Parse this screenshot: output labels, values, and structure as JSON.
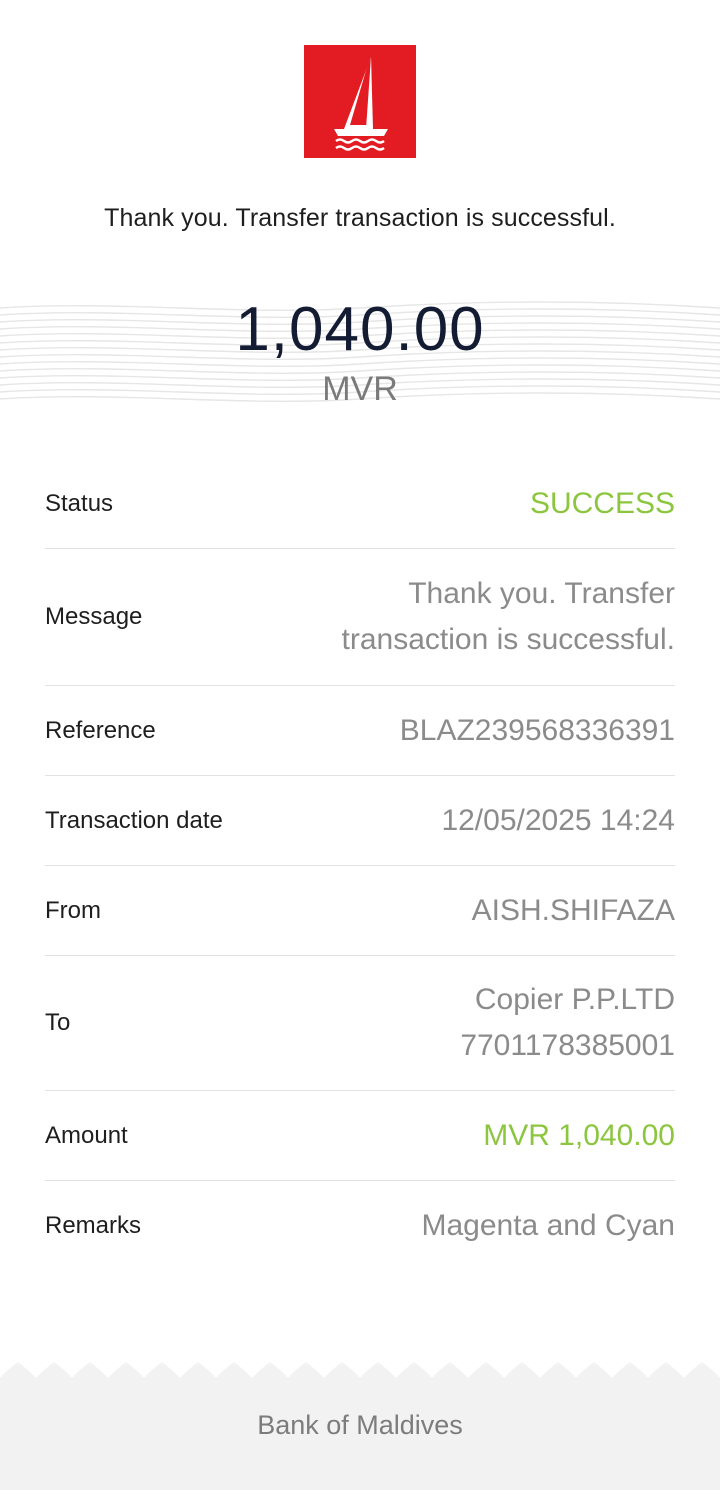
{
  "brand": {
    "logo_icon": "sailboat-icon",
    "logo_color": "#e31b23"
  },
  "confirmation": {
    "headline": "Thank you. Transfer transaction is successful.",
    "amount": "1,040.00",
    "currency": "MVR"
  },
  "details": {
    "status": {
      "label": "Status",
      "value": "SUCCESS"
    },
    "message": {
      "label": "Message",
      "value_line1": "Thank you. Transfer",
      "value_line2": "transaction is successful."
    },
    "reference": {
      "label": "Reference",
      "value": "BLAZ239568336391"
    },
    "transaction_date": {
      "label": "Transaction date",
      "value": "12/05/2025 14:24"
    },
    "from": {
      "label": "From",
      "value": "AISH.SHIFAZA"
    },
    "to": {
      "label": "To",
      "value_line1": "Copier P.P.LTD",
      "value_line2": "7701178385001"
    },
    "amount": {
      "label": "Amount",
      "value": "MVR 1,040.00"
    },
    "remarks": {
      "label": "Remarks",
      "value": "Magenta and Cyan"
    }
  },
  "colors": {
    "success": "#8cc63f",
    "amount_text": "#141c34"
  },
  "footer": {
    "text": "Bank of Maldives"
  }
}
